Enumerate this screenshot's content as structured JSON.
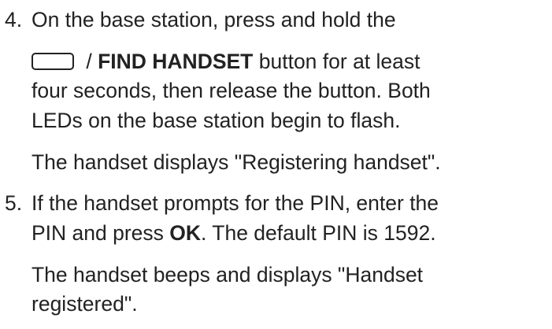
{
  "steps": [
    {
      "number": "4.",
      "lines": [
        "On the base station, press and hold the",
        {
          "pre": " / ",
          "bold": "FIND HANDSET",
          "post": " button for at least"
        },
        "four seconds, then release the button. Both",
        "LEDs on the base station begin to flash."
      ],
      "note": "The handset displays \"Registering handset\"."
    },
    {
      "number": "5.",
      "lines": [
        {
          "pre": "If the handset prompts for the PIN, enter the"
        },
        {
          "pre": "PIN and press ",
          "bold": "OK",
          "post": ". The default PIN is 1592."
        }
      ],
      "note_lines": [
        "The handset beeps and displays \"Handset",
        "registered\"."
      ]
    }
  ]
}
